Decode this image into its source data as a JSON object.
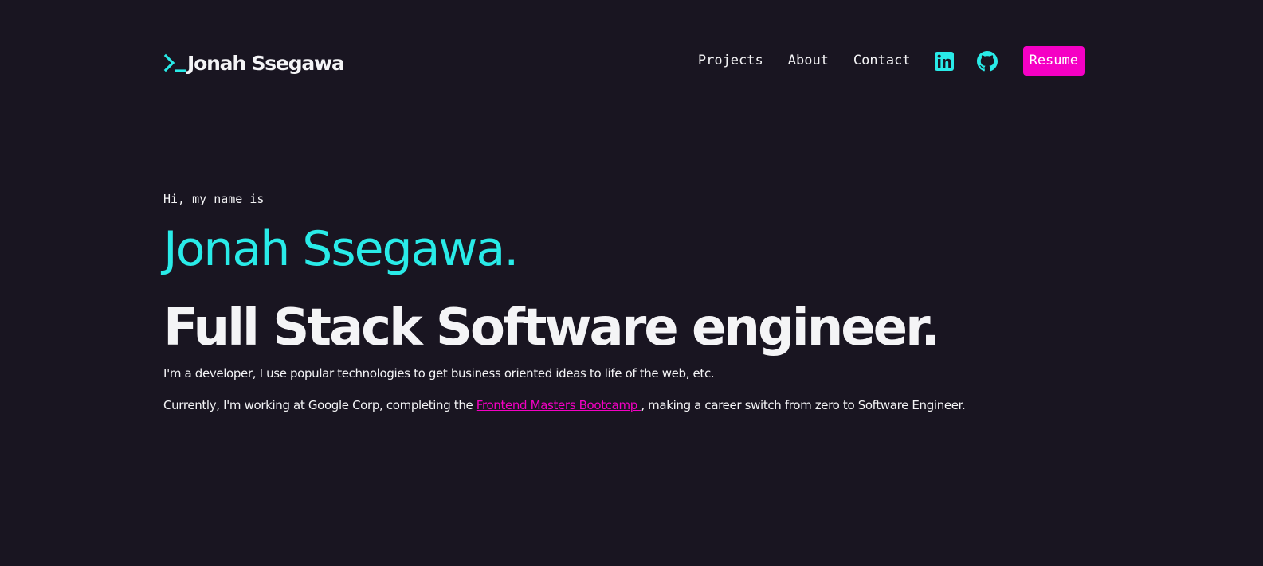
{
  "colors": {
    "background": "#191521",
    "accent_cyan": "#29ebe8",
    "accent_pink": "#f500c4",
    "text": "#f4f4f6"
  },
  "header": {
    "logo_icon": "terminal-prompt-icon",
    "logo_text": "Jonah Ssegawa",
    "nav": {
      "projects": "Projects",
      "about": "About",
      "contact": "Contact"
    },
    "icons": {
      "linkedin": "linkedin-icon",
      "github": "github-icon"
    },
    "resume_label": "Resume"
  },
  "hero": {
    "greeting": "Hi, my name is",
    "name": "Jonah Ssegawa.",
    "role": "Full Stack Software engineer.",
    "description": "I'm a developer, I use popular technologies to get business oriented ideas to life of the web, etc.",
    "current_prefix": "Currently, I'm working at Google Corp, completing the ",
    "current_link": "Frontend Masters Bootcamp ",
    "current_suffix": ", making a career switch from zero to Software Engineer."
  }
}
